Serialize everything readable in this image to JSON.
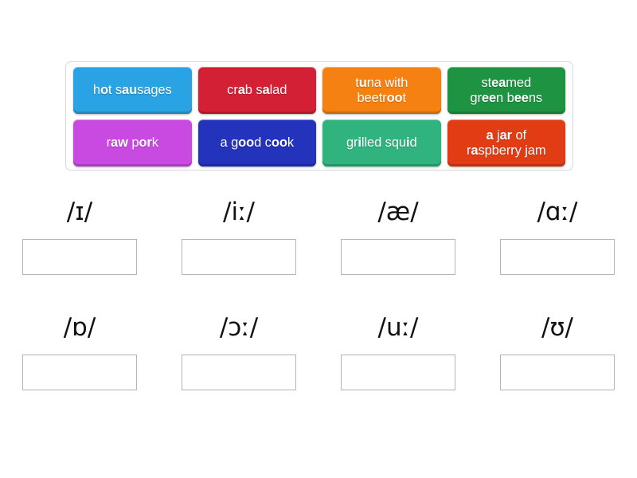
{
  "activity": {
    "type": "drag-and-drop-sorting",
    "tile_bank": {
      "rows": [
        [
          {
            "id": "tile-hot-sausages",
            "text": "hot sausages",
            "lines": [
              [
                {
                  "t": "h",
                  "b": false
                },
                {
                  "t": "o",
                  "b": true
                },
                {
                  "t": "t s",
                  "b": false
                },
                {
                  "t": "au",
                  "b": true
                },
                {
                  "t": "sages",
                  "b": false
                }
              ]
            ],
            "color": "#29a3e3"
          },
          {
            "id": "tile-crab-salad",
            "text": "crab salad",
            "lines": [
              [
                {
                  "t": "cr",
                  "b": false
                },
                {
                  "t": "a",
                  "b": true
                },
                {
                  "t": "b s",
                  "b": false
                },
                {
                  "t": "a",
                  "b": true
                },
                {
                  "t": "lad",
                  "b": false
                }
              ]
            ],
            "color": "#d42035"
          },
          {
            "id": "tile-tuna-with-beetroot",
            "text": "tuna with beetroot",
            "lines": [
              [
                {
                  "t": "t",
                  "b": false
                },
                {
                  "t": "u",
                  "b": true
                },
                {
                  "t": "na with",
                  "b": false
                }
              ],
              [
                {
                  "t": "beetr",
                  "b": false
                },
                {
                  "t": "oo",
                  "b": true
                },
                {
                  "t": "t",
                  "b": false
                }
              ]
            ],
            "color": "#f58113"
          },
          {
            "id": "tile-steamed-green-beens",
            "text": "steamed green beens",
            "lines": [
              [
                {
                  "t": "st",
                  "b": false
                },
                {
                  "t": "ea",
                  "b": true
                },
                {
                  "t": "med",
                  "b": false
                }
              ],
              [
                {
                  "t": "gr",
                  "b": false
                },
                {
                  "t": "ee",
                  "b": true
                },
                {
                  "t": "n b",
                  "b": false
                },
                {
                  "t": "ee",
                  "b": true
                },
                {
                  "t": "ns",
                  "b": false
                }
              ]
            ],
            "color": "#1e9443"
          }
        ],
        [
          {
            "id": "tile-raw-pork",
            "text": "raw pork",
            "lines": [
              [
                {
                  "t": "r",
                  "b": false
                },
                {
                  "t": "aw",
                  "b": true
                },
                {
                  "t": " p",
                  "b": false
                },
                {
                  "t": "or",
                  "b": true
                },
                {
                  "t": "k",
                  "b": false
                }
              ]
            ],
            "color": "#c94ae0"
          },
          {
            "id": "tile-a-good-cook",
            "text": "a good cook",
            "lines": [
              [
                {
                  "t": "a g",
                  "b": false
                },
                {
                  "t": "oo",
                  "b": true
                },
                {
                  "t": "d c",
                  "b": false
                },
                {
                  "t": "oo",
                  "b": true
                },
                {
                  "t": "k",
                  "b": false
                }
              ]
            ],
            "color": "#2433bb"
          },
          {
            "id": "tile-grilled-squid",
            "text": "grilled squid",
            "lines": [
              [
                {
                  "t": "gr",
                  "b": false
                },
                {
                  "t": "i",
                  "b": true
                },
                {
                  "t": "lled squ",
                  "b": false
                },
                {
                  "t": "i",
                  "b": true
                },
                {
                  "t": "d",
                  "b": false
                }
              ]
            ],
            "color": "#30b37e"
          },
          {
            "id": "tile-a-jar-of-raspberry-jam",
            "text": "a jar of raspberry jam",
            "lines": [
              [
                {
                  "t": "",
                  "b": false
                },
                {
                  "t": "a",
                  "b": true
                },
                {
                  "t": " j",
                  "b": false
                },
                {
                  "t": "ar",
                  "b": true
                },
                {
                  "t": " of",
                  "b": false
                }
              ],
              [
                {
                  "t": "r",
                  "b": false
                },
                {
                  "t": "a",
                  "b": true
                },
                {
                  "t": "spberry jam",
                  "b": false
                }
              ]
            ],
            "color": "#e23c14"
          }
        ]
      ]
    },
    "answer_rows": [
      [
        {
          "id": "zone-i-short",
          "phoneme": "/ɪ/",
          "value": ""
        },
        {
          "id": "zone-i-long",
          "phoneme": "/iː/",
          "value": ""
        },
        {
          "id": "zone-ae",
          "phoneme": "/æ/",
          "value": ""
        },
        {
          "id": "zone-a-long",
          "phoneme": "/ɑː/",
          "value": ""
        }
      ],
      [
        {
          "id": "zone-o-short",
          "phoneme": "/ɒ/",
          "value": ""
        },
        {
          "id": "zone-open-o-long",
          "phoneme": "/ɔː/",
          "value": ""
        },
        {
          "id": "zone-u-long",
          "phoneme": "/uː/",
          "value": ""
        },
        {
          "id": "zone-u-short",
          "phoneme": "/ʊ/",
          "value": ""
        }
      ]
    ]
  }
}
